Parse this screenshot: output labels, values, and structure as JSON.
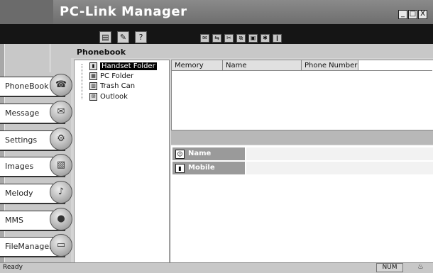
{
  "app": {
    "title": "PC-Link Manager"
  },
  "window_controls": {
    "minimize": "_",
    "maximize": "□",
    "close": "X"
  },
  "toolbar": {
    "primary_icons": [
      "save-icon",
      "edit-icon",
      "help-icon"
    ],
    "primary_glyphs": [
      "▤",
      "✎",
      "?"
    ],
    "secondary_icons": [
      "email-icon",
      "sync-icon",
      "cut-icon",
      "copy-icon",
      "paste-icon",
      "settings-icon",
      "info-icon"
    ],
    "secondary_glyphs": [
      "✉",
      "⇆",
      "✂",
      "⧉",
      "▣",
      "✱",
      "❙"
    ]
  },
  "sidebar": {
    "items": [
      {
        "label": "PhoneBook",
        "icon": "phone-icon",
        "glyph": "☎"
      },
      {
        "label": "Message",
        "icon": "envelope-icon",
        "glyph": "✉"
      },
      {
        "label": "Settings",
        "icon": "gear-icon",
        "glyph": "⚙"
      },
      {
        "label": "Images",
        "icon": "image-icon",
        "glyph": "▧"
      },
      {
        "label": "Melody",
        "icon": "music-icon",
        "glyph": "♪"
      },
      {
        "label": "MMS",
        "icon": "balloon-icon",
        "glyph": "●"
      },
      {
        "label": "FileManager",
        "icon": "folder-icon",
        "glyph": "▭"
      }
    ]
  },
  "phonebook": {
    "title": "Phonebook",
    "tree": [
      {
        "label": "Handset Folder",
        "icon": "handset-icon",
        "glyph": "▮",
        "selected": true
      },
      {
        "label": "PC Folder",
        "icon": "pc-icon",
        "glyph": "▦",
        "selected": false
      },
      {
        "label": "Trash Can",
        "icon": "trash-icon",
        "glyph": "▥",
        "selected": false
      },
      {
        "label": "Outlook",
        "icon": "outlook-icon",
        "glyph": "✉",
        "selected": false
      }
    ],
    "columns": [
      "Memory",
      "Name",
      "Phone Number",
      ""
    ],
    "fields": [
      {
        "label": "Name",
        "icon": "contact-icon",
        "glyph": "☺",
        "value": ""
      },
      {
        "label": "Mobile",
        "icon": "mobile-icon",
        "glyph": "▮",
        "value": ""
      }
    ]
  },
  "status": {
    "text": "Ready",
    "num": "NUM",
    "icon_glyph": "♨"
  }
}
